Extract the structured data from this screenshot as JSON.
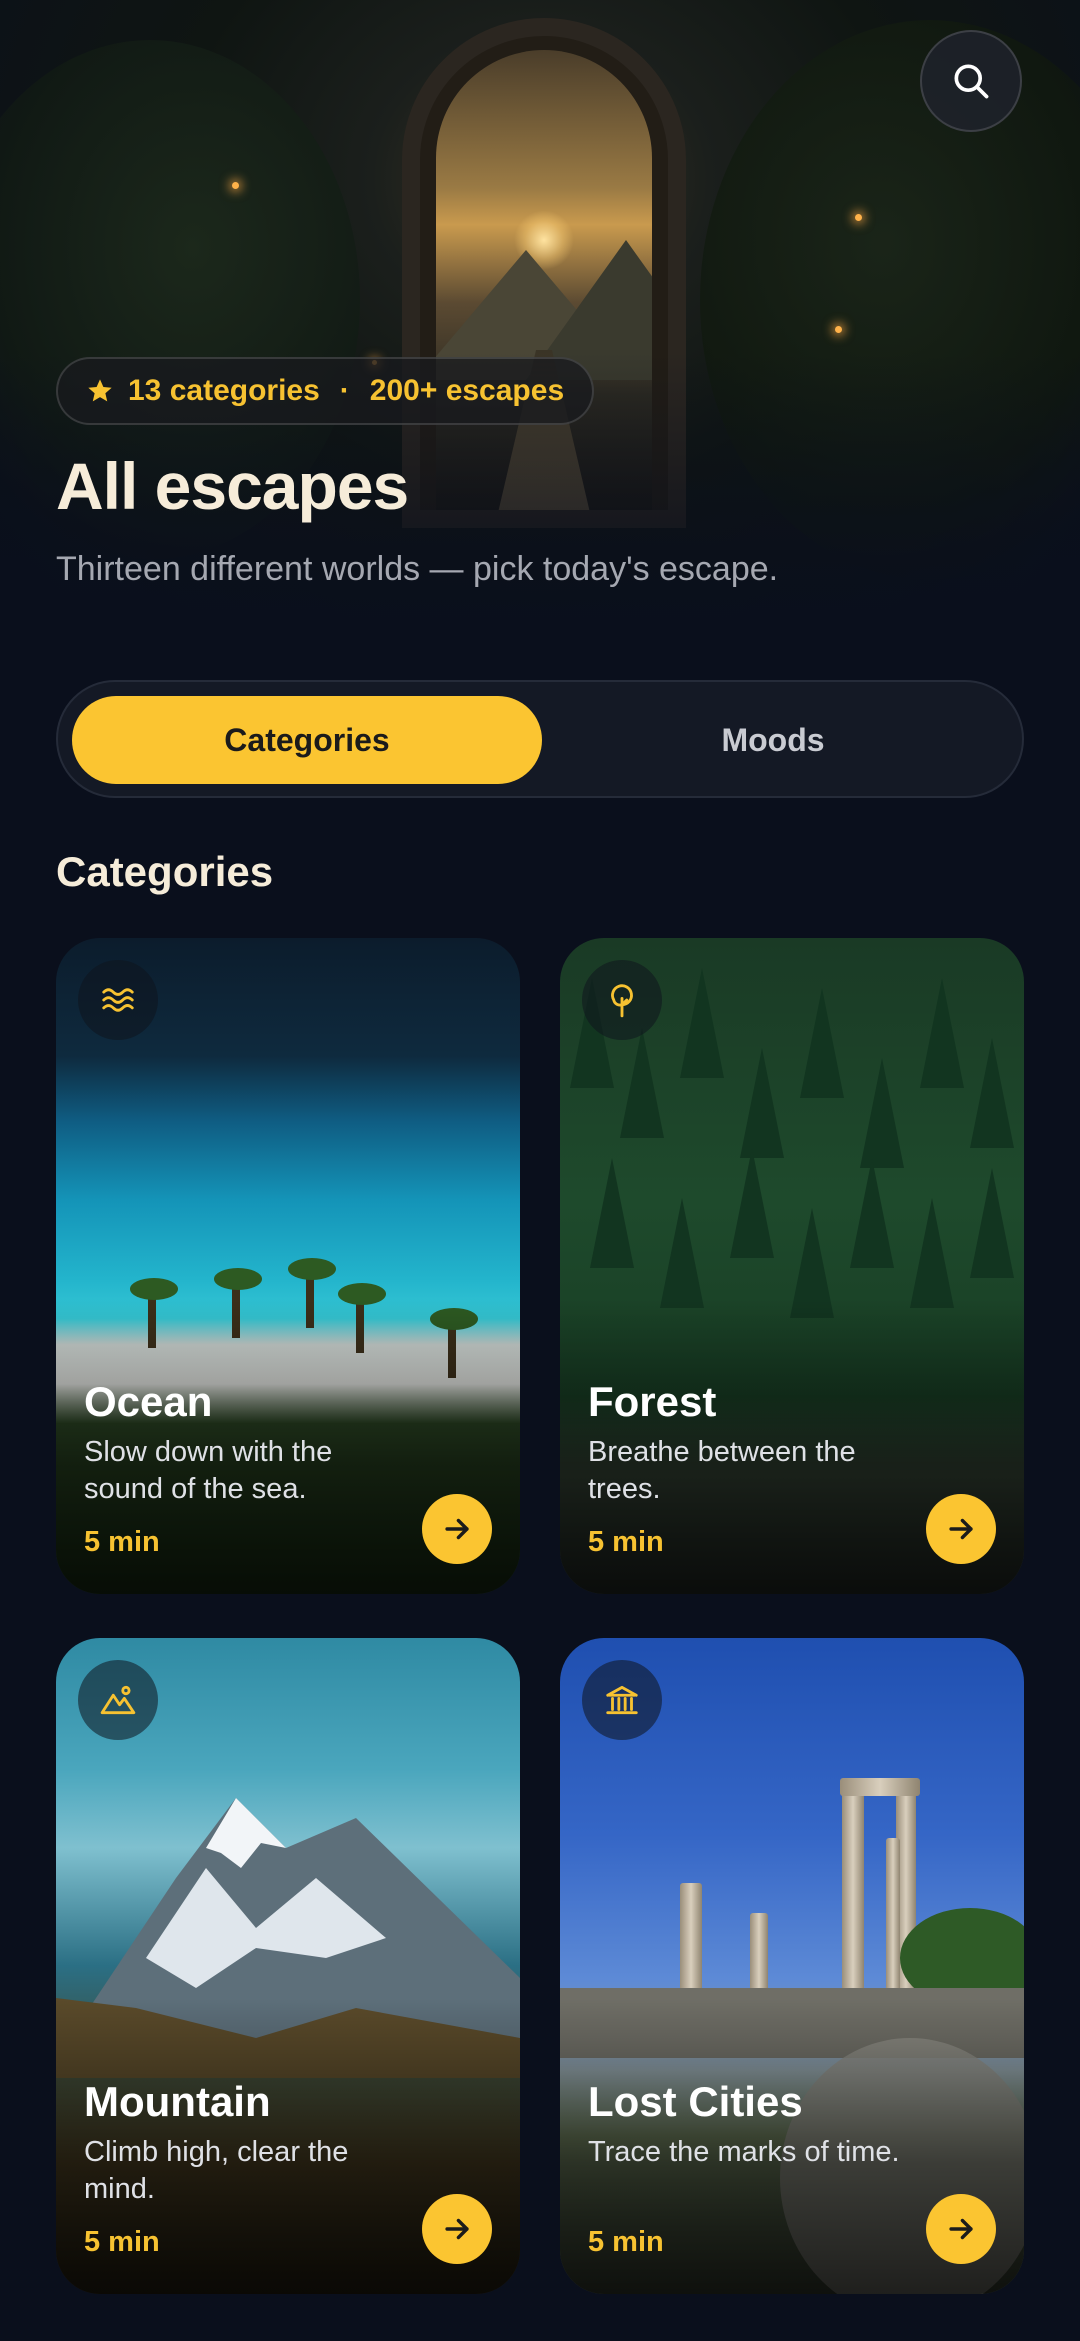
{
  "header": {
    "stats": {
      "categories": "13 categories",
      "separator": "·",
      "escapes": "200+ escapes"
    },
    "title": "All escapes",
    "subtitle": "Thirteen different worlds — pick today's escape."
  },
  "icons": {
    "search": "search-icon",
    "star": "star-icon",
    "arrow": "arrow-right-icon"
  },
  "toggle": {
    "options": [
      {
        "label": "Categories",
        "active": true
      },
      {
        "label": "Moods",
        "active": false
      }
    ]
  },
  "section": {
    "title": "Categories"
  },
  "cards": [
    {
      "name": "Ocean",
      "description": "Slow down with the sound of the sea.",
      "duration": "5 min",
      "icon": "waves-icon"
    },
    {
      "name": "Forest",
      "description": "Breathe between the trees.",
      "duration": "5 min",
      "icon": "tree-icon"
    },
    {
      "name": "Mountain",
      "description": "Climb high, clear the mind.",
      "duration": "5 min",
      "icon": "mountain-icon"
    },
    {
      "name": "Lost Cities",
      "description": "Trace the marks of time.",
      "duration": "5 min",
      "icon": "temple-icon"
    }
  ],
  "colors": {
    "background": "#0a0f1c",
    "accent": "#fbc531",
    "title": "#f6ecd9",
    "muted": "#a5a8b1"
  }
}
